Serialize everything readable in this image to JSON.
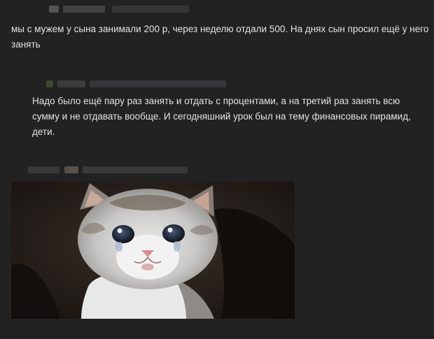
{
  "comments": [
    {
      "text": "мы с мужем у сына занимали 200 р, через неделю отдали 500. На днях сын просил ещё у него занять"
    },
    {
      "is_reply": true,
      "text": "Надо было ещё пару раз занять и отдать с процентами, а на третий раз занять всю сумму и не отдавать вообще. И сегодняшний урок был на тему финансовых пирамид, дети."
    },
    {
      "attachment": {
        "type": "image",
        "subject": "crying-kitten"
      }
    }
  ],
  "colors": {
    "background": "#222222",
    "text": "#e1e3e6"
  }
}
